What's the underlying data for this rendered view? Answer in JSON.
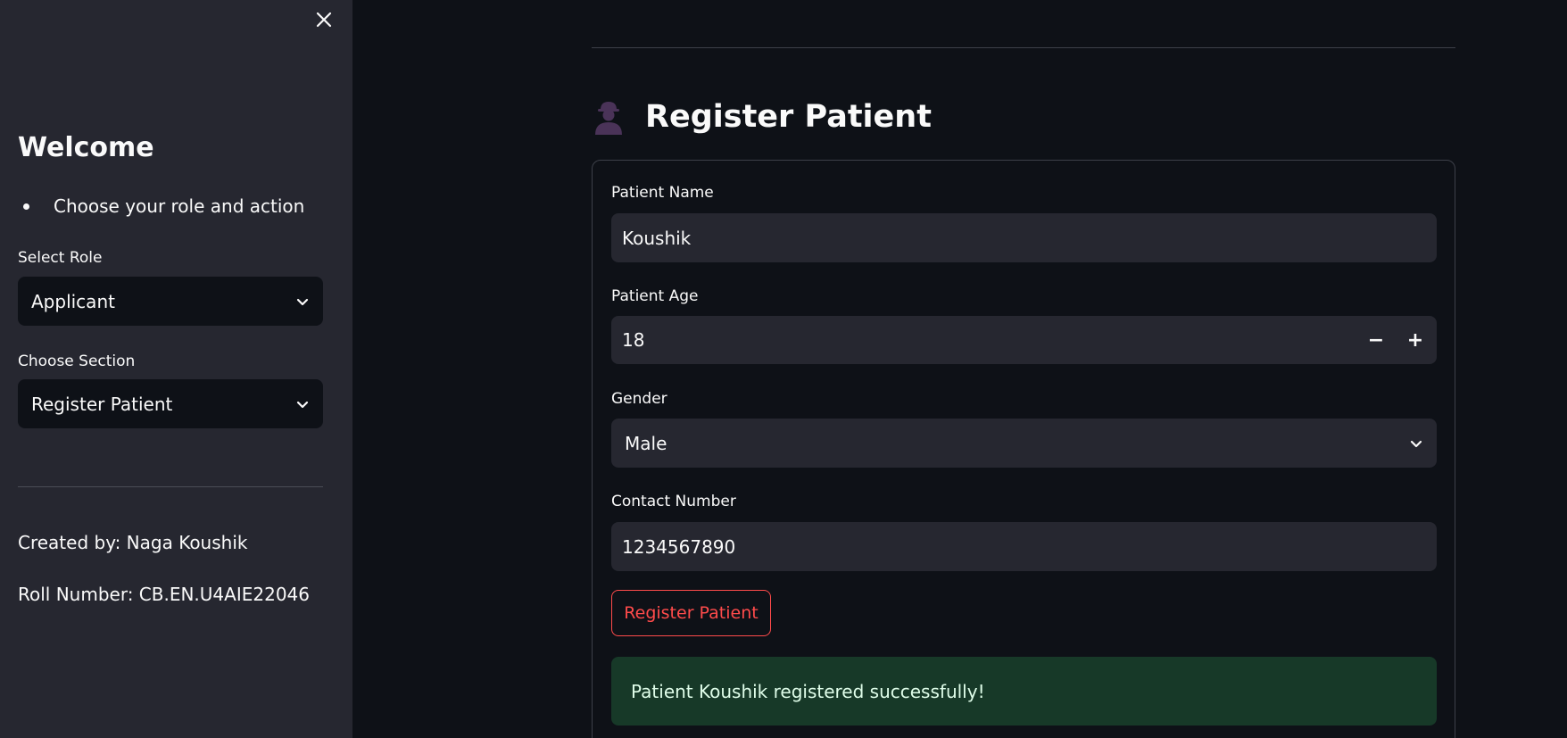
{
  "sidebar": {
    "close_icon": "close-icon",
    "title": "Welcome",
    "bullet": "Choose your role and action",
    "role_label": "Select Role",
    "role_value": "Applicant",
    "section_label": "Choose Section",
    "section_value": "Register Patient",
    "created_by": "Created by: Naga Koushik",
    "roll_number": "Roll Number: CB.EN.U4AIE22046"
  },
  "main": {
    "title": "Register Patient",
    "title_icon": "person-silhouette-icon",
    "form": {
      "name_label": "Patient Name",
      "name_value": "Koushik",
      "age_label": "Patient Age",
      "age_value": "18",
      "decrement": "−",
      "increment": "+",
      "gender_label": "Gender",
      "gender_value": "Male",
      "contact_label": "Contact Number",
      "contact_value": "1234567890",
      "submit_label": "Register Patient"
    },
    "success_message": "Patient Koushik registered successfully!"
  },
  "colors": {
    "background": "#0e1117",
    "sidebar": "#262730",
    "input": "#262730",
    "accent": "#ff4b4b",
    "success_bg": "#173928"
  }
}
